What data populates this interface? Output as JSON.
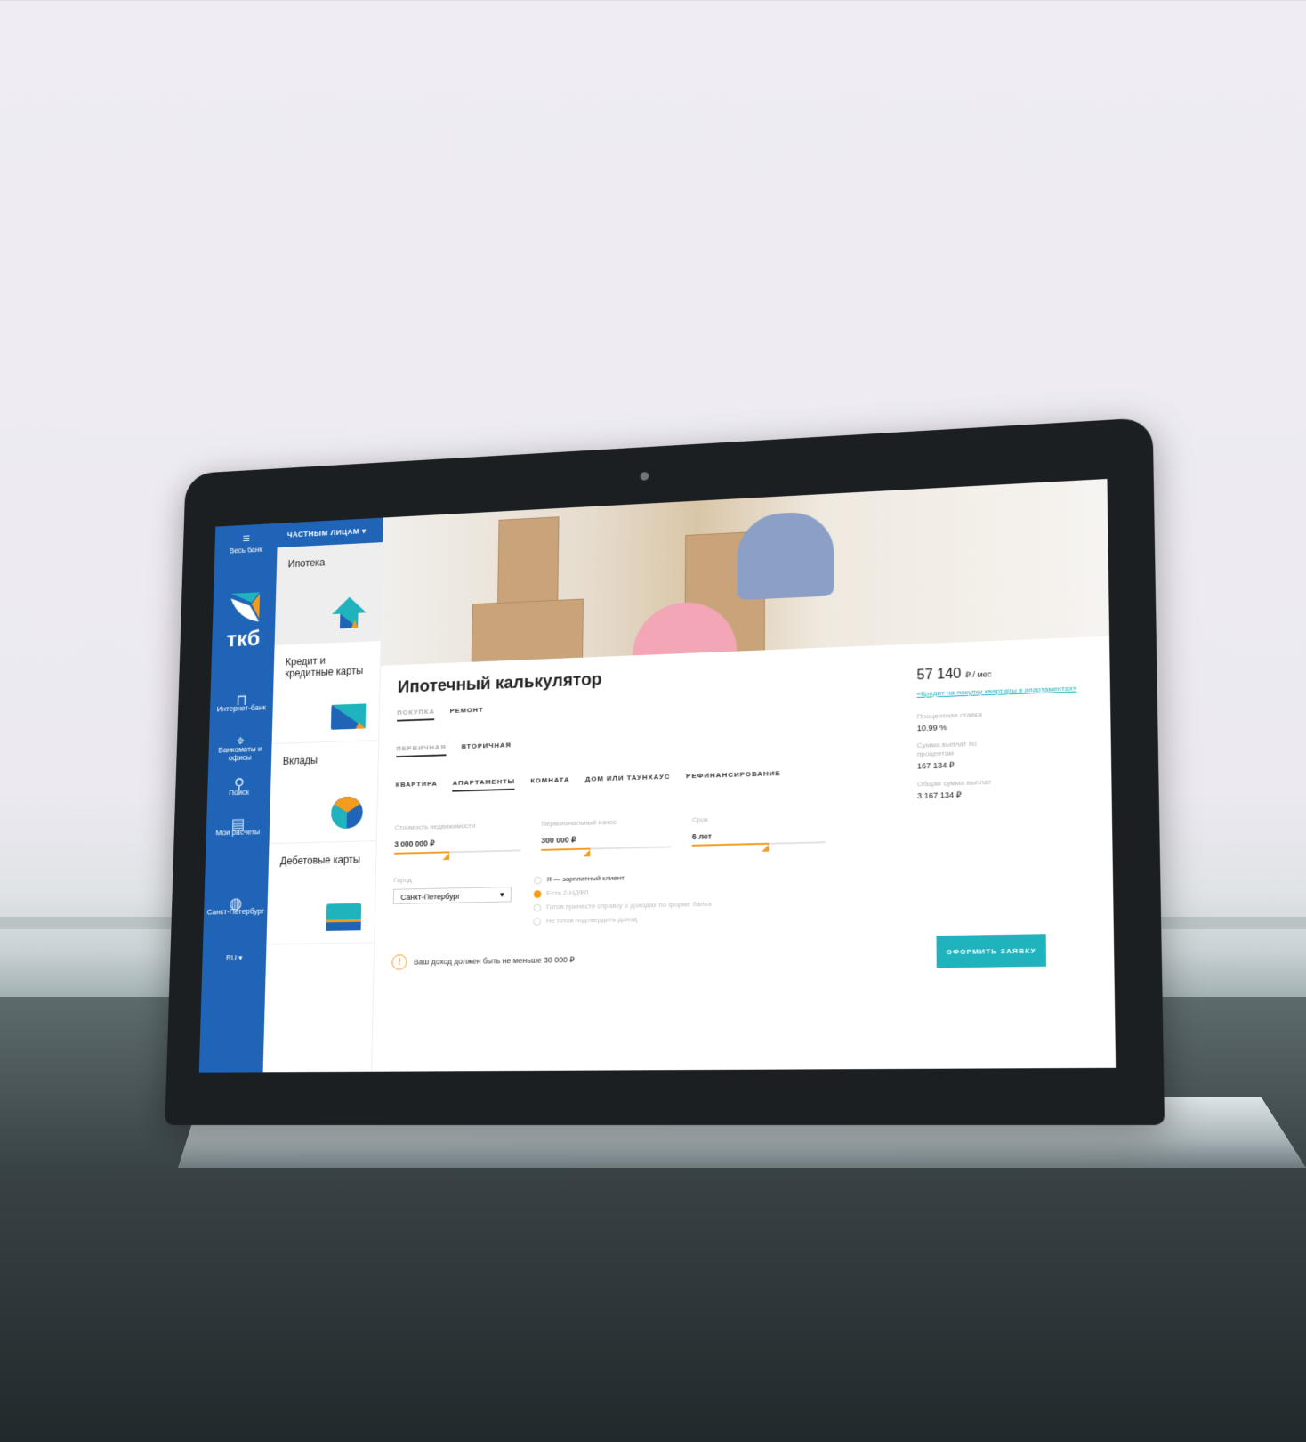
{
  "rail": {
    "menu_label": "Весь банк",
    "logo_text": "ткб",
    "items": [
      {
        "label": "Интернет-банк",
        "icon": "mouse-icon"
      },
      {
        "label": "Банкоматы и офисы",
        "icon": "location-pin-icon"
      },
      {
        "label": "Поиск",
        "icon": "search-icon"
      },
      {
        "label": "Мои расчеты",
        "icon": "calculator-icon"
      },
      {
        "label": "Санкт-Петербург",
        "icon": "globe-icon"
      }
    ],
    "language": "RU"
  },
  "topbar": {
    "segment": "ЧАСТНЫМ ЛИЦАМ"
  },
  "products": [
    {
      "label": "Ипотека"
    },
    {
      "label": "Кредит и кредитные карты"
    },
    {
      "label": "Вклады"
    },
    {
      "label": "Дебетовые карты"
    }
  ],
  "calculator": {
    "title": "Ипотечный калькулятор",
    "purpose_tabs": [
      "ПОКУПКА",
      "РЕМОНТ"
    ],
    "market_tabs": [
      "ПЕРВИЧНАЯ",
      "ВТОРИЧНАЯ"
    ],
    "property_tabs": [
      "КВАРТИРА",
      "АПАРТАМЕНТЫ",
      "КОМНАТА",
      "ДОМ ИЛИ ТАУНХАУС",
      "РЕФИНАНСИРОВАНИЕ"
    ],
    "fields": [
      {
        "label": "Стоимость недвижимости",
        "value": "3 000 000 ₽",
        "level": 0.44
      },
      {
        "label": "Первоначальный взнос",
        "value": "300 000 ₽",
        "level": 0.38
      },
      {
        "label": "Срок",
        "value": "6 лет",
        "level": 0.58
      }
    ],
    "city_label": "Город",
    "city_value": "Санкт-Петербург",
    "options": [
      {
        "label": "Я — зарплатный клиент",
        "checked": false
      },
      {
        "label": "Есть 2-НДФЛ",
        "checked": true
      },
      {
        "label": "Готов принести справку о доходах по форме банка",
        "checked": false
      },
      {
        "label": "Не готов подтвердить доход",
        "checked": false
      }
    ],
    "warning": "Ваш доход должен быть не меньше 30 000 ₽"
  },
  "summary": {
    "payment": "57 140",
    "payment_unit": "₽ / мес",
    "product_link": "«Кредит на покупку квартиры в апартаментах»",
    "stats": [
      {
        "label": "Процентная ставка",
        "value": "10.99 %"
      },
      {
        "label": "Сумма выплат по процентам",
        "value": "167 134 ₽"
      },
      {
        "label": "Общая сумма выплат",
        "value": "3 167 134 ₽"
      }
    ],
    "apply_label": "ОФОРМИТЬ ЗАЯВКУ"
  },
  "colors": {
    "brand_blue": "#1f64b6",
    "accent_orange": "#f39c1e",
    "teal": "#1fb3bd"
  }
}
